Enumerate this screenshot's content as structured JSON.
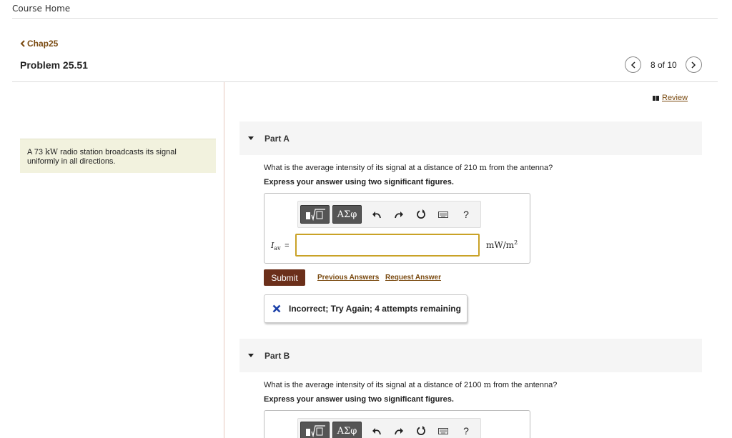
{
  "header": {
    "course_home": "Course Home"
  },
  "nav": {
    "back_label": "Chap25",
    "problem_title": "Problem 25.51",
    "pager_text": "8 of 10"
  },
  "review": {
    "label": "Review"
  },
  "problem": {
    "text_before": "A 73 ",
    "power_unit": "kW",
    "text_after": " radio station broadcasts its signal uniformly in all directions."
  },
  "parts": [
    {
      "label": "Part A",
      "question_before": "What is the average intensity of its signal at a distance of 210 ",
      "distance_unit": "m",
      "question_after": " from the antenna?",
      "instruction": "Express your answer using two significant figures.",
      "toolbar": {
        "greek": "ΑΣφ",
        "help": "?"
      },
      "variable": {
        "symbol": "I",
        "subscript": "av",
        "equals": "="
      },
      "answer_value": "",
      "unit": {
        "base": "mW/m",
        "exponent": "2"
      },
      "submit_label": "Submit",
      "previous_answers": "Previous Answers",
      "request_answer": "Request Answer",
      "feedback": "Incorrect; Try Again; 4 attempts remaining"
    },
    {
      "label": "Part B",
      "question_before": "What is the average intensity of its signal at a distance of 2100 ",
      "distance_unit": "m",
      "question_after": " from the antenna?",
      "instruction": "Express your answer using two significant figures.",
      "toolbar": {
        "greek": "ΑΣφ",
        "help": "?"
      }
    }
  ],
  "colors": {
    "link": "#7a4a10",
    "submit": "#6b2f1a",
    "input_border": "#c9a227",
    "problem_bg": "#f2f2de",
    "feedback_x": "#1a3fa8"
  },
  "icons": [
    "chevron-left-icon",
    "chevron-right-icon",
    "book-icon",
    "undo-icon",
    "redo-icon",
    "reset-icon",
    "keyboard-icon",
    "x-mark-icon",
    "collapse-triangle-icon"
  ]
}
